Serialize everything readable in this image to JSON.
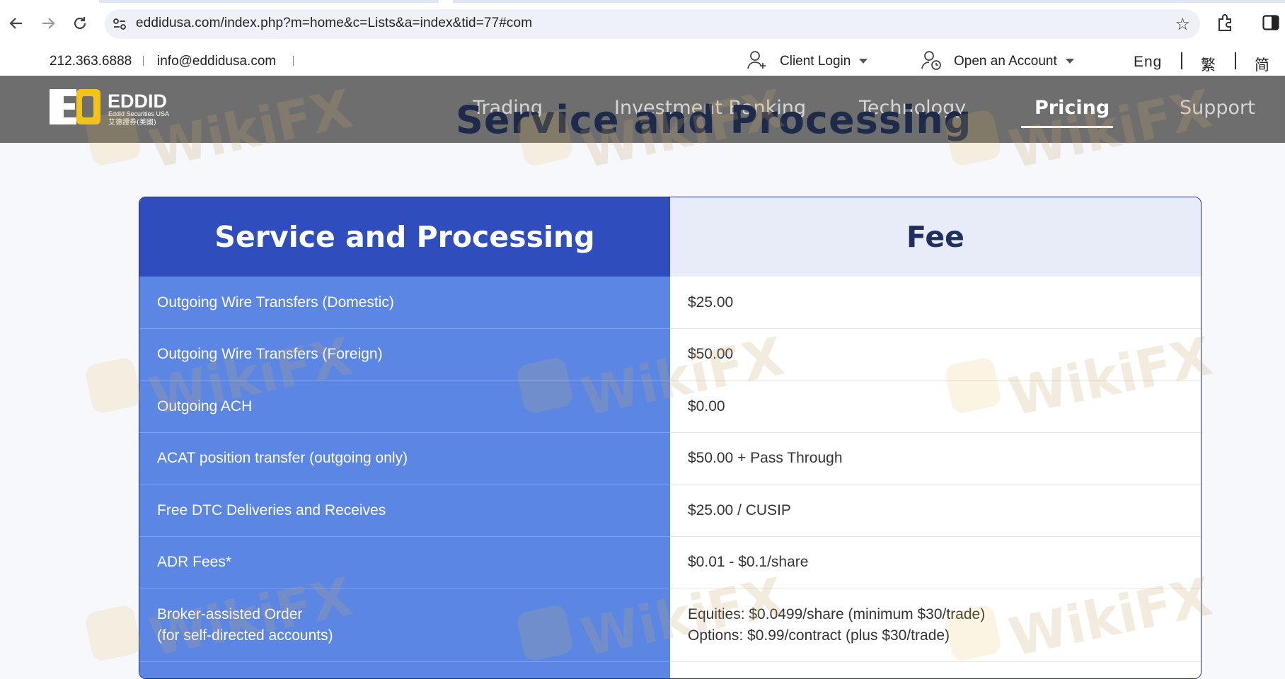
{
  "browser": {
    "url": "eddidusa.com/index.php?m=home&c=Lists&a=index&tid=77#com"
  },
  "utility_bar": {
    "phone": "212.363.6888",
    "email": "info@eddidusa.com",
    "client_login": "Client Login",
    "open_account": "Open an Account",
    "languages": [
      "Eng",
      "繁",
      "简"
    ]
  },
  "nav": {
    "links": [
      "Trading",
      "Investment Banking",
      "Technology",
      "Pricing",
      "Support"
    ],
    "active": "Pricing",
    "page_title": "Service and Processing"
  },
  "logo": {
    "brand": "EDDID",
    "subtitle": "Eddid Securities USA",
    "subtitle_cn": "艾德證券(美國)"
  },
  "table": {
    "headers": [
      "Service and Processing",
      "Fee"
    ],
    "rows": [
      {
        "service": [
          "Outgoing Wire Transfers (Domestic)"
        ],
        "fee": [
          "$25.00"
        ]
      },
      {
        "service": [
          "Outgoing Wire Transfers (Foreign)"
        ],
        "fee": [
          "$50.00"
        ]
      },
      {
        "service": [
          "Outgoing ACH"
        ],
        "fee": [
          "$0.00"
        ]
      },
      {
        "service": [
          "ACAT position transfer (outgoing only)"
        ],
        "fee": [
          "$50.00 + Pass Through"
        ]
      },
      {
        "service": [
          "Free DTC Deliveries and Receives"
        ],
        "fee": [
          "$25.00 / CUSIP"
        ]
      },
      {
        "service": [
          "ADR Fees*"
        ],
        "fee": [
          "$0.01 - $0.1/share"
        ]
      },
      {
        "service": [
          "Broker-assisted Order",
          "(for self-directed accounts)"
        ],
        "fee": [
          "Equities: $0.0499/share (minimum $30/trade)",
          "Options: $0.99/contract (plus $30/trade)"
        ]
      }
    ]
  },
  "watermark": {
    "text": "WikiFX"
  },
  "colors": {
    "header_blue": "#2f4dbd",
    "row_blue": "#5b86e4",
    "nav_gray": "#6e6e6e",
    "logo_yellow": "#f2c318"
  }
}
